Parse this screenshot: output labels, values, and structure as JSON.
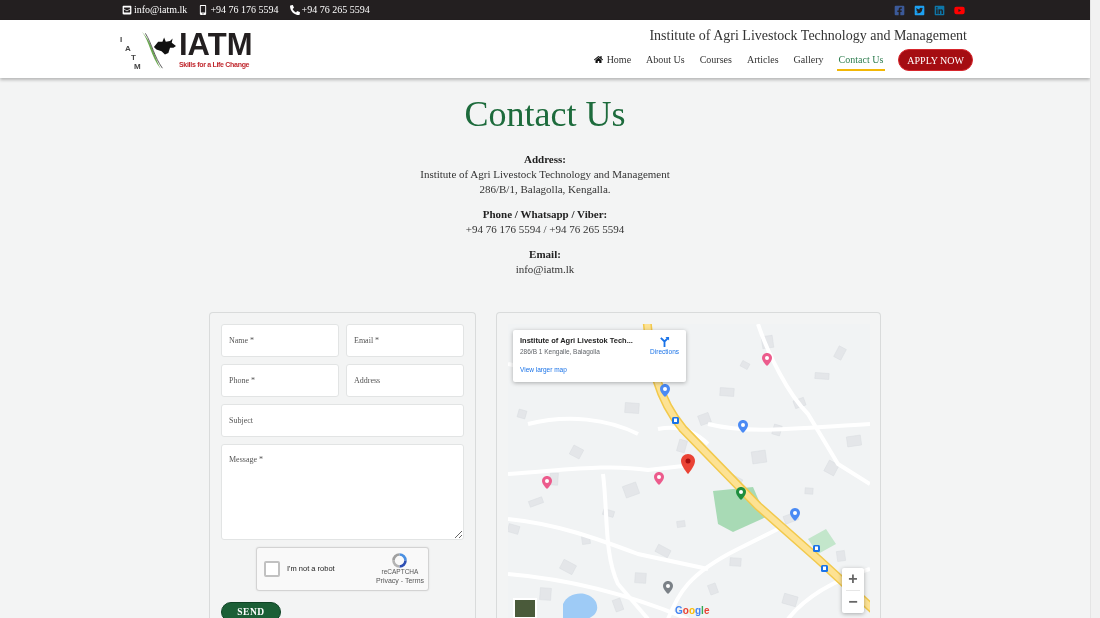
{
  "top_bar": {
    "contacts": [
      {
        "kind": "email",
        "text": "info@iatm.lk"
      },
      {
        "kind": "mobile",
        "text": "+94 76 176 5594"
      },
      {
        "kind": "phone",
        "text": "+94 76 265 5594"
      }
    ],
    "social": [
      {
        "kind": "facebook"
      },
      {
        "kind": "twitter"
      },
      {
        "kind": "linkedin"
      },
      {
        "kind": "youtube"
      }
    ]
  },
  "header": {
    "logo": {
      "side_letters": [
        "I",
        "A",
        "T",
        "M"
      ],
      "name": "IATM",
      "tagline": "Skills for a Life Change"
    },
    "title": "Institute of Agri Livestock Technology and Management",
    "nav": [
      {
        "kind": "home",
        "label": "Home",
        "selected": false
      },
      {
        "kind": "link",
        "label": "About Us",
        "selected": false
      },
      {
        "kind": "link",
        "label": "Courses",
        "selected": false
      },
      {
        "kind": "link",
        "label": "Articles",
        "selected": false
      },
      {
        "kind": "link",
        "label": "Gallery",
        "selected": false
      },
      {
        "kind": "link",
        "label": "Contact Us",
        "selected": true
      }
    ],
    "apply_button": "APPLY NOW"
  },
  "contact": {
    "heading": "Contact Us",
    "sections": [
      {
        "label": "Address:",
        "lines": [
          "Institute of Agri Livestock Technology and Management",
          "286/B/1, Balagolla, Kengalla."
        ]
      },
      {
        "label": "Phone / Whatsapp / Viber:",
        "lines": [
          "+94 76 176 5594 / +94 76 265 5594"
        ]
      },
      {
        "label": "Email:",
        "lines": [
          "info@iatm.lk"
        ]
      }
    ]
  },
  "form": {
    "fields": [
      {
        "kind": "half",
        "placeholder": "Name *"
      },
      {
        "kind": "half",
        "placeholder": "Email *"
      },
      {
        "kind": "half",
        "placeholder": "Phone *"
      },
      {
        "kind": "half",
        "placeholder": "Address"
      },
      {
        "kind": "full",
        "placeholder": "Subject"
      },
      {
        "kind": "textarea",
        "placeholder": "Message *"
      }
    ],
    "captcha": {
      "checked": false,
      "label": "I'm not a robot",
      "brand": "reCAPTCHA",
      "links": "Privacy - Terms"
    },
    "submit": "SEND"
  },
  "map": {
    "info_card": {
      "place": "Institute of Agri Livestok Tech...",
      "address": "286/B 1 Kengalle, Balagolla",
      "directions": "Directions",
      "link": "View larger map"
    },
    "zoom_in": "+",
    "zoom_out": "−",
    "attribution": "Google"
  }
}
